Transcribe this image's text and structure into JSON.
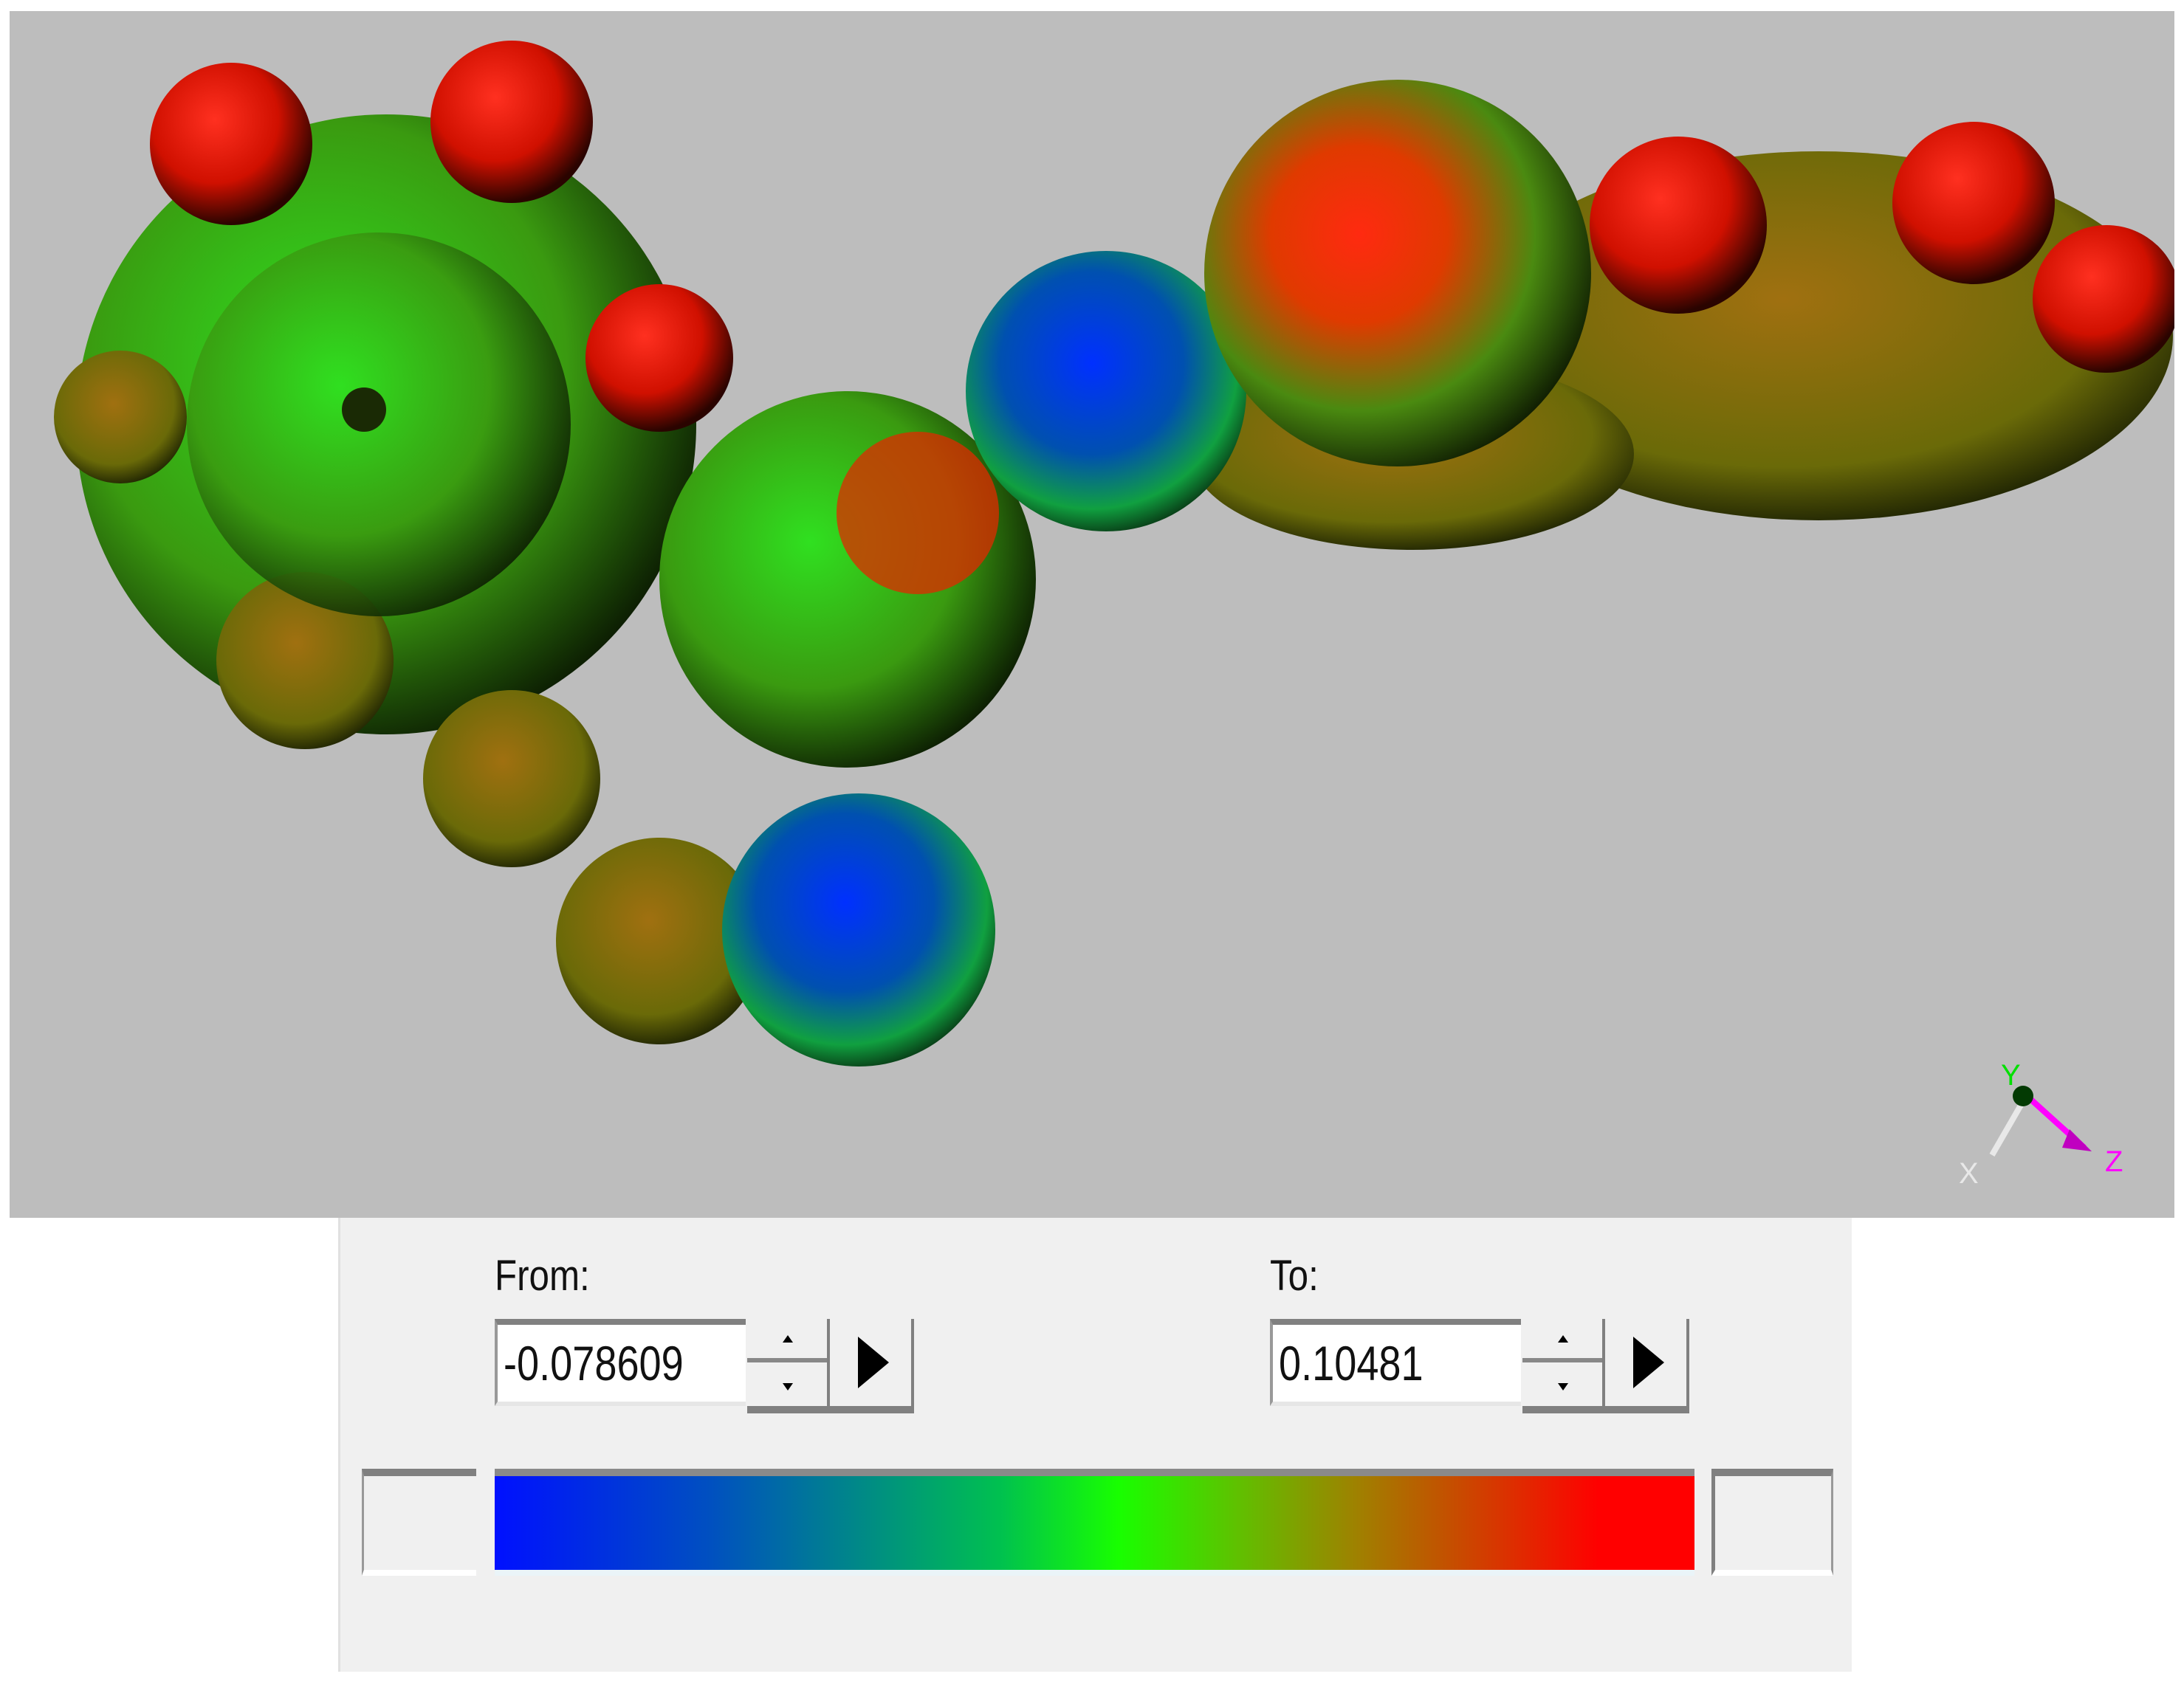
{
  "viewport": {
    "background_color": "#bdbdbd",
    "axes": {
      "x_label": "X",
      "y_label": "Y",
      "z_label": "Z",
      "x_color": "#e8e8e8",
      "y_color": "#00e000",
      "z_color": "#ff00ff"
    }
  },
  "range_panel": {
    "from_label": "From:",
    "from_value": "-0.078609",
    "to_label": "To:",
    "to_value": "0.10481",
    "colormap": [
      "#0010ff",
      "#009080",
      "#18ff00",
      "#a08000",
      "#ff0000"
    ]
  }
}
